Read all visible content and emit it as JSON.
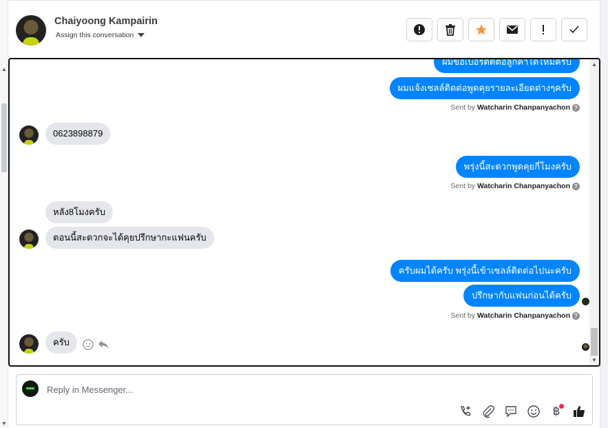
{
  "header": {
    "contact_name": "Chaiyoong Kampairin",
    "assign_label": "Assign this conversation",
    "actions": [
      {
        "name": "report-spam-button",
        "icon": "alert-circle-icon"
      },
      {
        "name": "delete-button",
        "icon": "trash-icon"
      },
      {
        "name": "star-button",
        "icon": "star-icon"
      },
      {
        "name": "mark-unread-button",
        "icon": "envelope-icon"
      },
      {
        "name": "follow-up-button",
        "icon": "exclamation-icon"
      },
      {
        "name": "mark-done-button",
        "icon": "checkmark-icon"
      }
    ],
    "star_color": "#f7923a"
  },
  "messages": {
    "out_1": "ผมขอเบอร์ติดต่อลูกค้าได้ไหมครับ",
    "out_2": "ผมแจ้งเซลล์ติดต่อพูดคุยรายละเอียดต่างๆครับ",
    "in_1": "0623898879",
    "out_3": "พรุ่งนี้สะดวกพูดคุยกี่โมงครับ",
    "in_2": "หลัง8โมงครับ",
    "in_3": "ตอนนี้สะดวกจะได้คุยปรึกษากะแฟนครับ",
    "out_4": "ครับผมได้ครับ พรุ่งนี้เข้าเซลล์ติดต่อไปนะครับ",
    "out_5": "ปรึกษากับแฟนก่อนได้ครับ",
    "in_4": "ครับ"
  },
  "sent_by": {
    "prefix": "Sent by",
    "agent": "Watcharin Chanpanyachon",
    "help": "?"
  },
  "composer": {
    "placeholder": "Reply in Messenger...",
    "tools": [
      "call-icon",
      "attachment-icon",
      "saved-replies-icon",
      "emoji-icon",
      "payment-icon",
      "like-icon"
    ]
  },
  "colors": {
    "outgoing_bubble": "#0084ff",
    "incoming_bubble": "#e4e6eb",
    "notification_dot": "#f02849"
  }
}
